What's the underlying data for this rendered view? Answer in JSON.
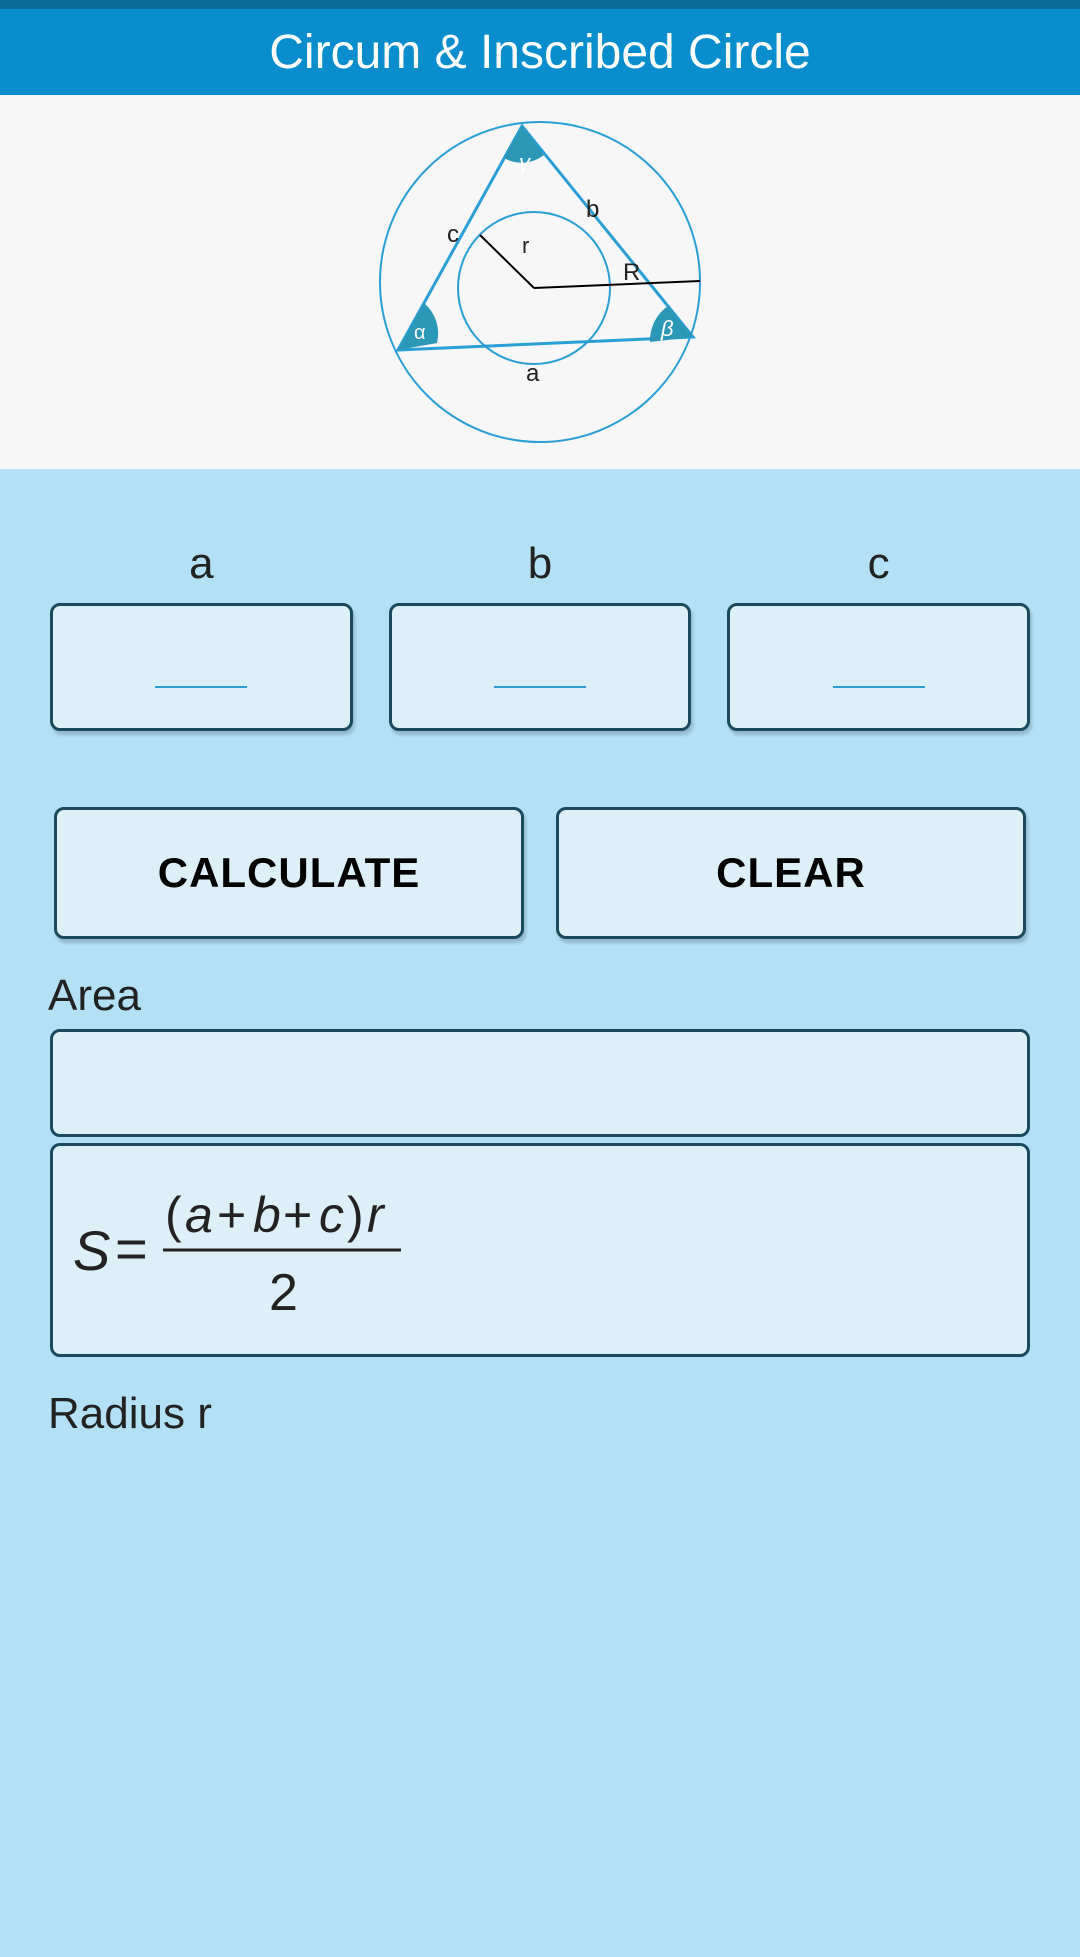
{
  "header": {
    "title": "Circum & Inscribed Circle"
  },
  "diagram": {
    "labels": {
      "a": "a",
      "b": "b",
      "c": "c",
      "r": "r",
      "R": "R",
      "alpha": "α",
      "beta": "β",
      "gamma": "γ"
    }
  },
  "inputs": {
    "a": {
      "label": "a",
      "value": ""
    },
    "b": {
      "label": "b",
      "value": ""
    },
    "c": {
      "label": "c",
      "value": ""
    }
  },
  "buttons": {
    "calculate": "CALCULATE",
    "clear": "CLEAR"
  },
  "results": {
    "area": {
      "label": "Area",
      "value": ""
    },
    "area_formula": {
      "s": "S",
      "eq": "=",
      "num": "(a + b + c)r",
      "den": "2"
    },
    "radius_r": {
      "label": "Radius r",
      "value": ""
    }
  }
}
